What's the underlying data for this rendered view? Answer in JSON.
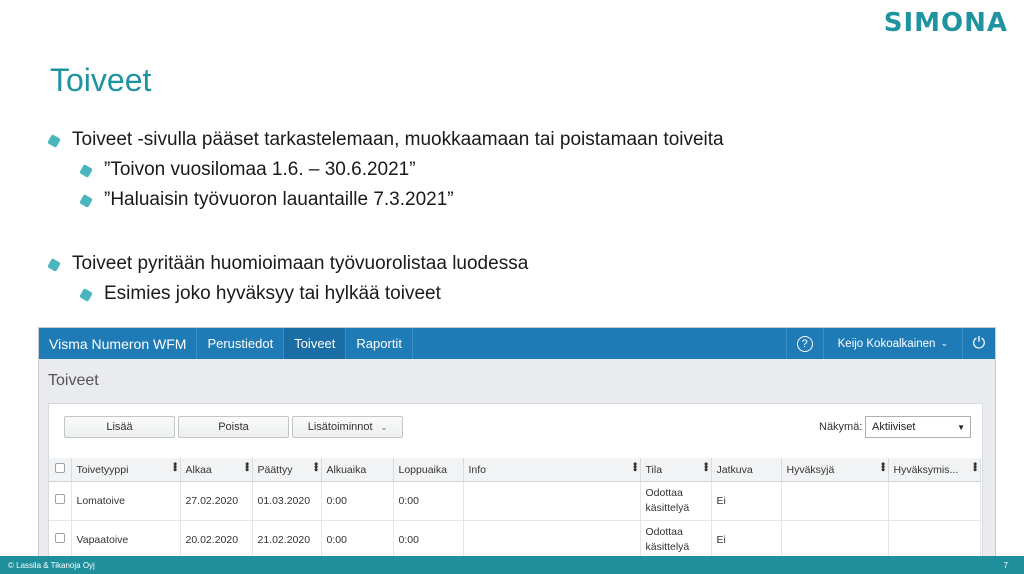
{
  "slide": {
    "logo": "SIMONA",
    "title": "Toiveet",
    "bullets": [
      "Toiveet -sivulla pääset tarkastelemaan, muokkaamaan tai poistamaan toiveita",
      "”Toivon vuosilomaa 1.6. – 30.6.2021”",
      "”Haluaisin työvuoron lauantaille 7.3.2021”",
      "Toiveet pyritään huomioimaan työvuorolistaa luodessa",
      "Esimies joko hyväksyy tai hylkää toiveet"
    ],
    "footer_copyright": "© Lassila & Tikanoja Oyj",
    "page_number": "7"
  },
  "app": {
    "brand": "Visma Numeron WFM",
    "nav": [
      "Perustiedot",
      "Toiveet",
      "Raportit"
    ],
    "help_glyph": "?",
    "user": "Keijo Kokoalkainen",
    "user_chevron": "⌄",
    "power_glyph": "⏻",
    "page_title": "Toiveet",
    "toolbar": {
      "add": "Lisää",
      "delete": "Poista",
      "more": "Lisätoiminnot",
      "more_chevron": "⌄",
      "view_label": "Näkymä:",
      "view_value": "Aktiiviset",
      "view_arrow": "▼"
    },
    "table": {
      "menu_glyph": "•••",
      "headers": [
        "Toivetyyppi",
        "Alkaa",
        "Päättyy",
        "Alkuaika",
        "Loppuaika",
        "Info",
        "Tila",
        "Jatkuva",
        "Hyväksyjä",
        "Hyväksymis..."
      ],
      "rows": [
        [
          "Lomatoive",
          "27.02.2020",
          "01.03.2020",
          "0:00",
          "0:00",
          "",
          "Odottaa käsittelyä",
          "Ei",
          "",
          ""
        ],
        [
          "Vapaatoive",
          "20.02.2020",
          "21.02.2020",
          "0:00",
          "0:00",
          "",
          "Odottaa käsittelyä",
          "Ei",
          "",
          ""
        ]
      ]
    }
  },
  "colors": {
    "accent": "#1f93a0",
    "nav_blue": "#1f7bb6"
  }
}
